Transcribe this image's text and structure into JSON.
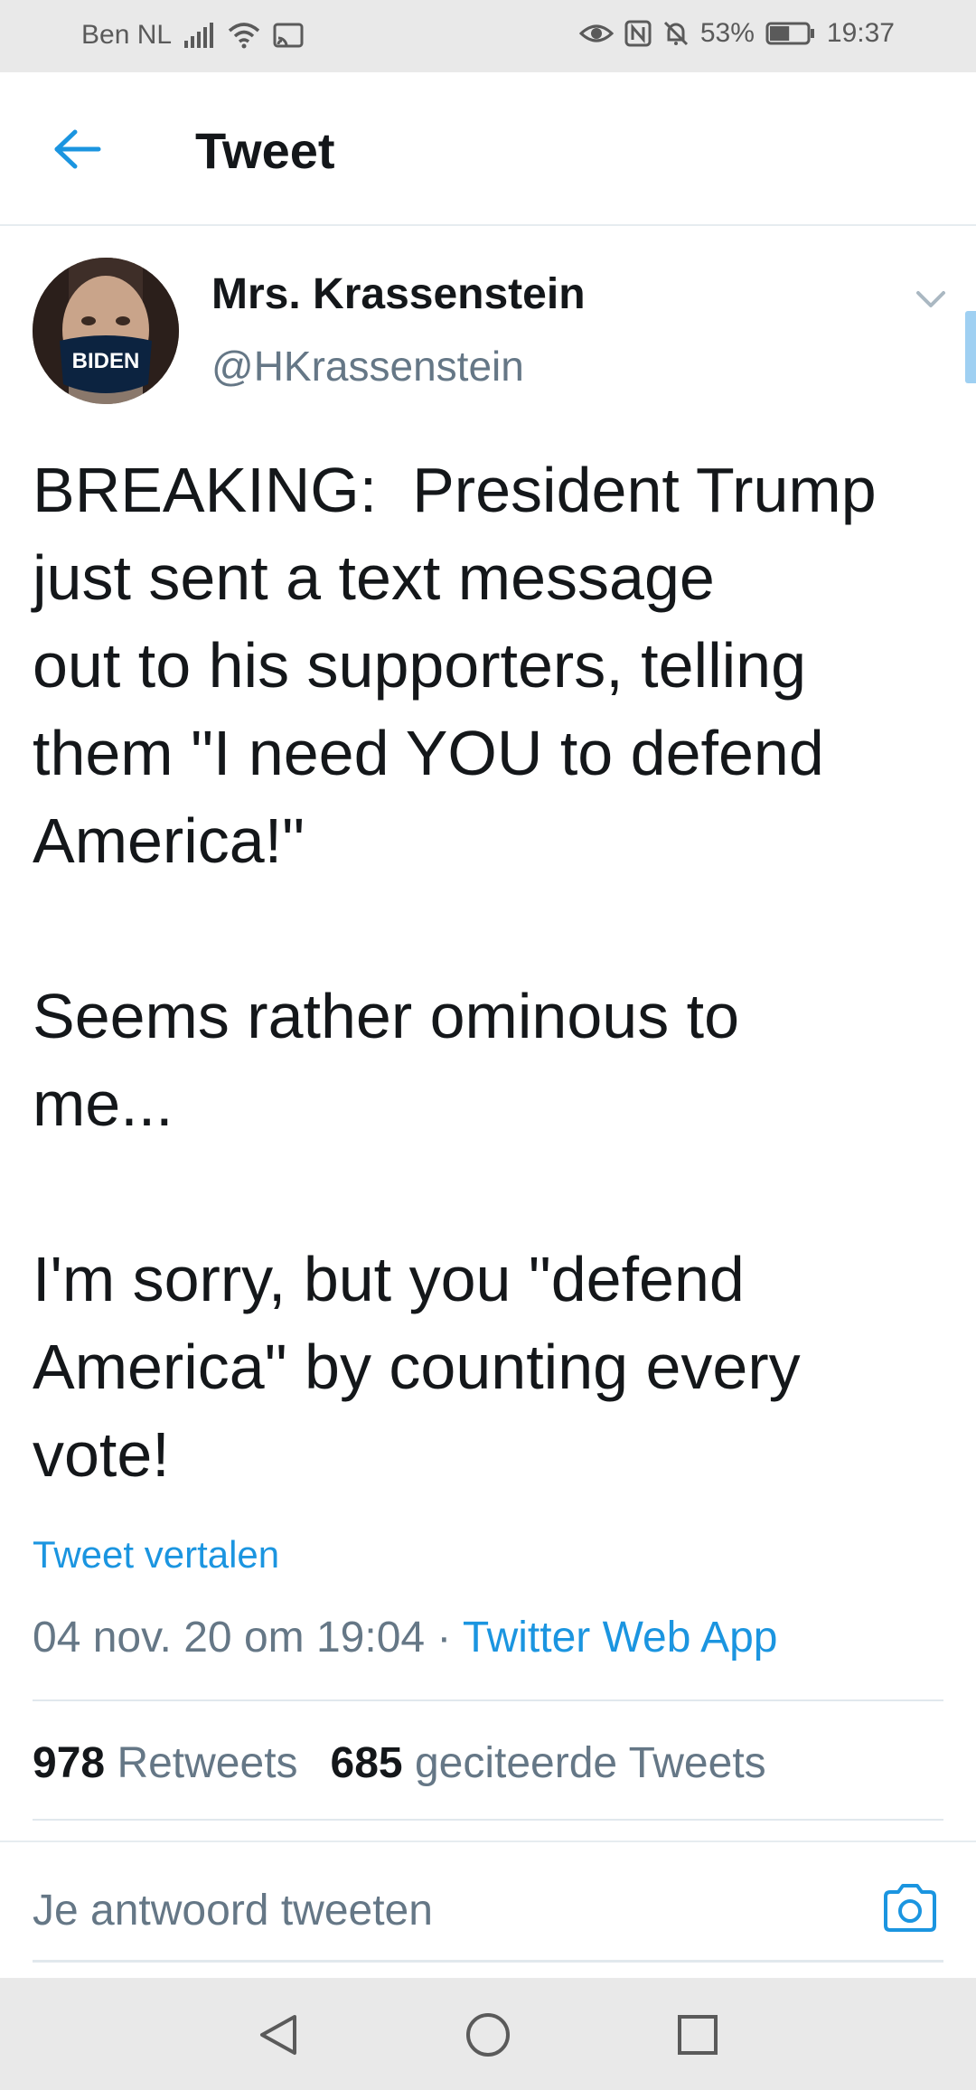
{
  "status_bar": {
    "carrier": "Ben NL",
    "battery_percent": "53%",
    "time": "19:37",
    "battery_level": 0.53,
    "icons": [
      "signal-icon",
      "wifi-icon",
      "cast-icon",
      "eye-icon",
      "nfc-icon",
      "mute-icon",
      "battery-icon"
    ]
  },
  "header": {
    "title": "Tweet",
    "back_icon": "arrow-left-icon"
  },
  "tweet": {
    "author_name": "Mrs. Krassenstein",
    "author_handle": "@HKrassenstein",
    "text": "BREAKING:  President Trump\njust sent a text message\nout to his supporters, telling\nthem \"I need YOU to defend\nAmerica!\"\n\nSeems rather ominous to\nme...\n\nI'm sorry, but you \"defend\nAmerica\" by counting every\nvote!",
    "translate_label": "Tweet vertalen",
    "timestamp": "04 nov. 20 om 19:04",
    "separator": " · ",
    "source": "Twitter Web App",
    "retweets_count": "978",
    "retweets_label": "Retweets",
    "quotes_count": "685",
    "quotes_label": "geciteerde Tweets",
    "avatar_mask_text": "BIDEN"
  },
  "reply": {
    "placeholder": "Je antwoord tweeten",
    "camera_icon": "camera-icon"
  },
  "nav_bar": {
    "icons": [
      "back-triangle-icon",
      "home-circle-icon",
      "recents-square-icon"
    ]
  },
  "colors": {
    "accent": "#1b95e0",
    "text": "#14171a",
    "secondary": "#657786",
    "divider": "#e1e8ed",
    "system_bar": "#e9e9e9"
  }
}
